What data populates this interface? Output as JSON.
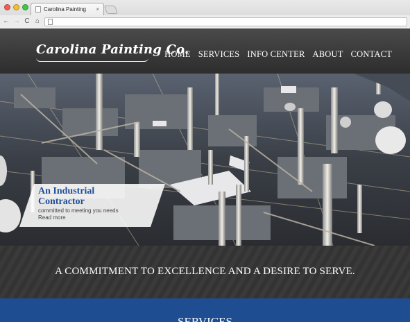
{
  "browser": {
    "tab_title": "Carolina Painting",
    "tab_close": "×",
    "back_glyph": "←",
    "forward_glyph": "→",
    "reload_glyph": "C",
    "home_glyph": "⌂",
    "traffic_lights": [
      "#f15f56",
      "#f6bd2f",
      "#3ec84a"
    ]
  },
  "header": {
    "logo_text": "Carolina Painting Co.",
    "nav": [
      "HOME",
      "SERVICES",
      "INFO CENTER",
      "ABOUT",
      "CONTACT"
    ]
  },
  "hero": {
    "title": "An Industrial Contractor",
    "subtitle": "committed to meeting you needs",
    "link": "Read more"
  },
  "tagline": "A COMMITMENT TO EXCELLENCE AND A DESIRE TO SERVE.",
  "services_heading": "SERVICES",
  "colors": {
    "header_bg": "#3a3a3a",
    "accent_blue": "#1f4d92",
    "caption_title": "#1e4f96"
  }
}
